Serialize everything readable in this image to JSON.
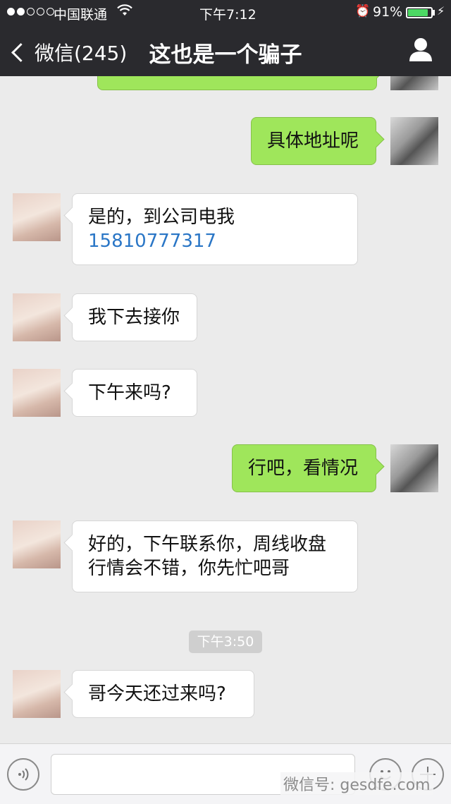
{
  "status_bar": {
    "carrier": "中国联通",
    "time": "下午7:12",
    "battery": "91%",
    "battery_level": 0.91,
    "signal_bars": 2
  },
  "nav": {
    "back_label": "微信(245)",
    "title": "这也是一个骗子"
  },
  "messages": [
    {
      "side": "out",
      "lines": [
        "具体地址呢"
      ]
    },
    {
      "side": "in",
      "lines": [
        "是的，到公司电我"
      ],
      "phone": "15810777317"
    },
    {
      "side": "in",
      "lines": [
        "我下去接你"
      ]
    },
    {
      "side": "in",
      "lines": [
        "下午来吗?"
      ]
    },
    {
      "side": "out",
      "lines": [
        "行吧，看情况"
      ]
    },
    {
      "side": "in",
      "lines": [
        "好的，下午联系你，周线收盘",
        "行情会不错，你先忙吧哥"
      ]
    },
    {
      "side": "in",
      "lines": [
        "哥今天还过来吗?"
      ]
    }
  ],
  "timestamp": "下午3:50",
  "watermark": "微信号: gesdfe.com",
  "colors": {
    "outgoing_bubble": "#9fe65b",
    "link": "#2a76c6",
    "header": "#2a2a2e"
  },
  "icons": {
    "voice": "voice-icon",
    "emoji": "emoji-icon",
    "more": "plus-icon",
    "profile": "person-icon",
    "back": "chevron-left-icon"
  }
}
